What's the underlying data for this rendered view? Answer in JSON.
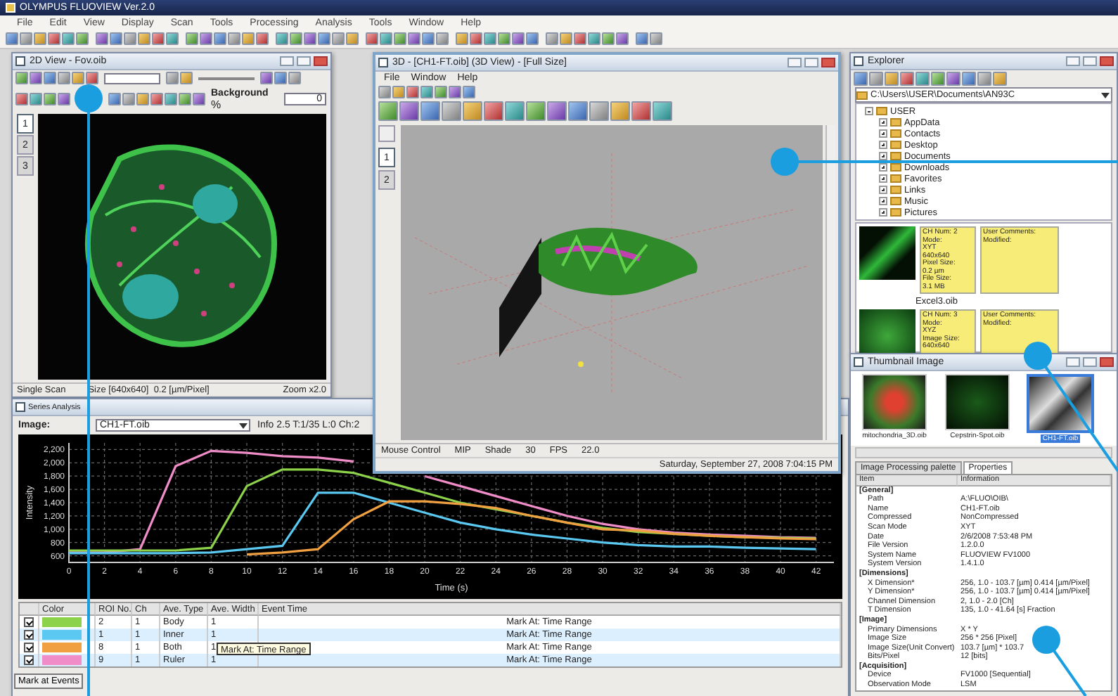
{
  "app": {
    "title": "OLYMPUS FLUOVIEW Ver.2.0",
    "menu": [
      "File",
      "Edit",
      "View",
      "Display",
      "Scan",
      "Tools",
      "Processing",
      "Analysis",
      "Tools",
      "Window",
      "Help"
    ]
  },
  "view2d": {
    "title": "2D View - Fov.oib",
    "background_label": "Background",
    "background_unit": "%",
    "background_value": "0",
    "side_tabs": [
      {
        "label": "1",
        "selected": true
      },
      {
        "label": "2",
        "selected": false
      },
      {
        "label": "3",
        "selected": false
      }
    ],
    "status_left": [
      "Single Scan",
      "Size [640x640]  0.2 [µm/Pixel]"
    ],
    "status_right": "Zoom x2.0"
  },
  "view3d": {
    "title": "3D - [CH1-FT.oib] (3D View) - [Full Size]",
    "menu": [
      "File",
      "Window",
      "Help"
    ],
    "side_tabs": [
      {
        "label": "1",
        "selected": true
      },
      {
        "label": "2",
        "selected": false
      }
    ],
    "status": [
      "Mouse Control",
      "MIP",
      "Shade",
      "30",
      "FPS",
      "22.0"
    ],
    "date": "Saturday, September 27, 2008 7:04:15 PM"
  },
  "series": {
    "title": "Series Analysis",
    "image_label": "Image:",
    "image_value": "CH1-FT.oib",
    "info": "Info 2.5 T:1/35 L:0 Ch:2",
    "chart_data": {
      "type": "line",
      "xlabel": "Time (s)",
      "ylabel": "Intensity",
      "x": [
        0,
        2,
        4,
        6,
        8,
        10,
        12,
        14,
        16,
        18,
        20,
        22,
        24,
        26,
        28,
        30,
        32,
        34,
        36,
        38,
        40,
        42
      ],
      "series": [
        {
          "color": "#f08cc8",
          "values": [
            650,
            650,
            700,
            1950,
            2180,
            2150,
            2100,
            2080,
            2020,
            null,
            1800,
            1650,
            1500,
            1350,
            1200,
            1080,
            1000,
            950,
            920,
            900,
            880,
            870
          ]
        },
        {
          "color": "#8cd24a",
          "values": [
            680,
            680,
            680,
            680,
            720,
            1650,
            1900,
            1900,
            1850,
            1700,
            1550,
            1400,
            1300,
            1200,
            1100,
            1020,
            960,
            930,
            900,
            880,
            870,
            860
          ]
        },
        {
          "color": "#5ac8f0",
          "values": [
            640,
            640,
            640,
            640,
            650,
            700,
            750,
            1550,
            1550,
            1400,
            1250,
            1100,
            1000,
            920,
            860,
            800,
            760,
            740,
            740,
            720,
            710,
            700
          ]
        },
        {
          "color": "#f0a040",
          "values": [
            null,
            null,
            null,
            null,
            null,
            620,
            650,
            700,
            1150,
            1420,
            1420,
            1380,
            1320,
            1200,
            1100,
            1000,
            980,
            930,
            900,
            880,
            860,
            850
          ]
        }
      ],
      "grid": true,
      "xlim": [
        0,
        43
      ],
      "ylim": [
        500,
        2300
      ],
      "xticks": [
        0,
        2,
        4,
        6,
        8,
        10,
        12,
        14,
        16,
        18,
        20,
        22,
        24,
        26,
        28,
        30,
        32,
        34,
        36,
        38,
        40,
        42
      ],
      "yticks": [
        {
          "value": 600,
          "label": "600"
        },
        {
          "value": 800,
          "label": "800"
        },
        {
          "value": 1000,
          "label": "1,000"
        },
        {
          "value": 1200,
          "label": "1,200"
        },
        {
          "value": 1400,
          "label": "1,400"
        },
        {
          "value": 1600,
          "label": "1,600"
        },
        {
          "value": 1800,
          "label": "1,800"
        },
        {
          "value": 2000,
          "label": "2,000"
        },
        {
          "value": 2200,
          "label": "2,200"
        }
      ]
    },
    "color_column": "Color",
    "columns": [
      "ROI No.",
      "Ch",
      "Ave. Type",
      "Ave. Width",
      "Event Time"
    ],
    "rows": [
      {
        "checked": true,
        "color": "#8cd24a",
        "cells": [
          "2",
          "1",
          "Body",
          "1",
          "Mark At: Time Range"
        ]
      },
      {
        "checked": true,
        "color": "#5ac8f0",
        "cells": [
          "1",
          "1",
          "Inner",
          "1",
          "Mark At: Time Range"
        ]
      },
      {
        "checked": true,
        "color": "#f0a040",
        "cells": [
          "8",
          "1",
          "Both",
          "1",
          "Mark At: Time Range"
        ]
      },
      {
        "checked": true,
        "color": "#f08cc8",
        "cells": [
          "9",
          "1",
          "Ruler",
          "1",
          "Mark At: Time Range"
        ]
      }
    ],
    "tooltip": "Mark At: Time Range",
    "button": "Mark at Events"
  },
  "explorer": {
    "title": "Explorer",
    "path": "C:\\Users\\USER\\Documents\\AN93C",
    "tree": [
      {
        "label": "USER",
        "expanded": true,
        "children": [
          {
            "label": "AppData",
            "expanded": false
          },
          {
            "label": "Contacts",
            "expanded": false
          },
          {
            "label": "Desktop",
            "expanded": false
          },
          {
            "label": "Documents",
            "expanded": false
          },
          {
            "label": "Downloads",
            "expanded": false
          },
          {
            "label": "Favorites",
            "expanded": false
          },
          {
            "label": "Links",
            "expanded": false
          },
          {
            "label": "Music",
            "expanded": false
          },
          {
            "label": "Pictures",
            "expanded": false
          }
        ]
      }
    ],
    "cards": [
      {
        "info": [
          "CH Num: 2",
          "Mode:",
          "XYT",
          "640x640",
          "Pixel Size:",
          "0.2 µm",
          "File Size:",
          "3.1 MB"
        ],
        "comments": [
          "User Comments:",
          "Modified:"
        ],
        "name": "Excel3.oib"
      },
      {
        "info": [
          "CH Num: 3",
          "Mode:",
          "XYZ",
          "Image Size:",
          "640x640"
        ],
        "comments": [
          "User Comments:",
          "Modified:"
        ]
      }
    ]
  },
  "thumbs": {
    "title": "Thumbnail Image",
    "items": [
      {
        "name": "mitochondria_3D.oib",
        "selected": false
      },
      {
        "name": "Cepstrin-Spot.oib",
        "selected": false
      },
      {
        "name": "CH1-FT.oib",
        "selected": true
      }
    ],
    "tabs": [
      {
        "label": "Image Processing palette",
        "selected": false
      },
      {
        "label": "Properties",
        "selected": true
      }
    ],
    "columns": [
      "Item",
      "Information"
    ],
    "rows": [
      {
        "kind": "group",
        "label": "[General]"
      },
      {
        "kind": "item",
        "label": "Path",
        "value": "A:\\FLUO\\OIB\\"
      },
      {
        "kind": "item",
        "label": "Name",
        "value": "CH1-FT.oib"
      },
      {
        "kind": "item",
        "label": "Compressed",
        "value": "NonCompressed"
      },
      {
        "kind": "item",
        "label": "Scan Mode",
        "value": "XYT"
      },
      {
        "kind": "item",
        "label": "Date",
        "value": "2/6/2008 7:53:48 PM"
      },
      {
        "kind": "item",
        "label": "File Version",
        "value": "1.2.0.0"
      },
      {
        "kind": "item",
        "label": "System Name",
        "value": "FLUOVIEW FV1000"
      },
      {
        "kind": "item",
        "label": "System Version",
        "value": "1.4.1.0"
      },
      {
        "kind": "group",
        "label": "[Dimensions]"
      },
      {
        "kind": "item",
        "label": "X Dimension*",
        "value": "256, 1.0 - 103.7 [µm] 0.414 [µm/Pixel]"
      },
      {
        "kind": "item",
        "label": "Y Dimension*",
        "value": "256, 1.0 - 103.7 [µm] 0.414 [µm/Pixel]"
      },
      {
        "kind": "item",
        "label": "Channel Dimension",
        "value": "2, 1.0 - 2.0 [Ch]"
      },
      {
        "kind": "item",
        "label": "T Dimension",
        "value": "135, 1.0 - 41.64 [s] Fraction"
      },
      {
        "kind": "group",
        "label": "[Image]"
      },
      {
        "kind": "item",
        "label": "Primary Dimensions",
        "value": "X * Y"
      },
      {
        "kind": "item",
        "label": "Image Size",
        "value": "256 * 256 [Pixel]"
      },
      {
        "kind": "item",
        "label": "Image Size(Unit Convert)",
        "value": "103.7 [µm] * 103.7"
      },
      {
        "kind": "item",
        "label": "Bits/Pixel",
        "value": "12 [bits]"
      },
      {
        "kind": "group",
        "label": "[Acquisition]"
      },
      {
        "kind": "item",
        "label": "Device",
        "value": "FV1000 [Sequential]"
      },
      {
        "kind": "item",
        "label": "Observation Mode",
        "value": "LSM"
      }
    ]
  }
}
